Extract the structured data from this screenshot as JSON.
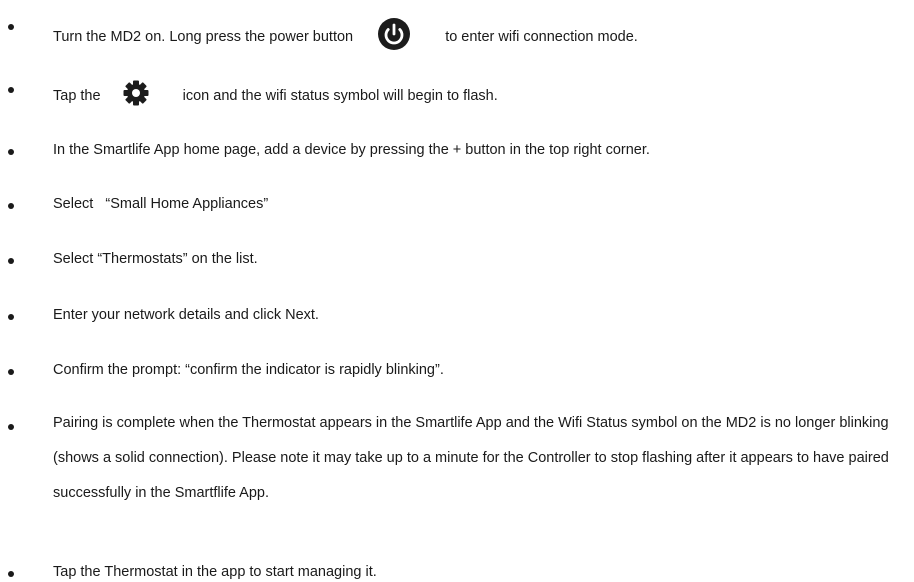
{
  "steps": [
    {
      "before": "Turn the MD2 on. Long press the power button",
      "icon": "power-icon",
      "after": "to enter wifi connection mode."
    },
    {
      "before": "Tap  the",
      "icon": "gear-icon",
      "after": "icon and the wifi status symbol will begin to flash."
    },
    {
      "text": "In the Smartlife App home page, add a device by pressing the + button in the top right corner."
    },
    {
      "text": "Select   “Small Home Appliances”"
    },
    {
      "text": "Select “Thermostats” on the list."
    },
    {
      "text": "Enter your network details and click Next."
    },
    {
      "text": "Confirm the prompt: “confirm the indicator is rapidly blinking”."
    },
    {
      "text": "Pairing is complete when the Thermostat appears in the Smartlife App and the Wifi Status symbol on the MD2 is no longer blinking (shows a solid connection). Please note it may take up to a minute for the Controller to stop flashing after it appears to have paired successfully in the Smartflife App."
    },
    {
      "text": "Tap the Thermostat in the app to start managing it."
    }
  ],
  "colors": {
    "text": "#1a1a1a",
    "icon": "#1c1c1c"
  }
}
